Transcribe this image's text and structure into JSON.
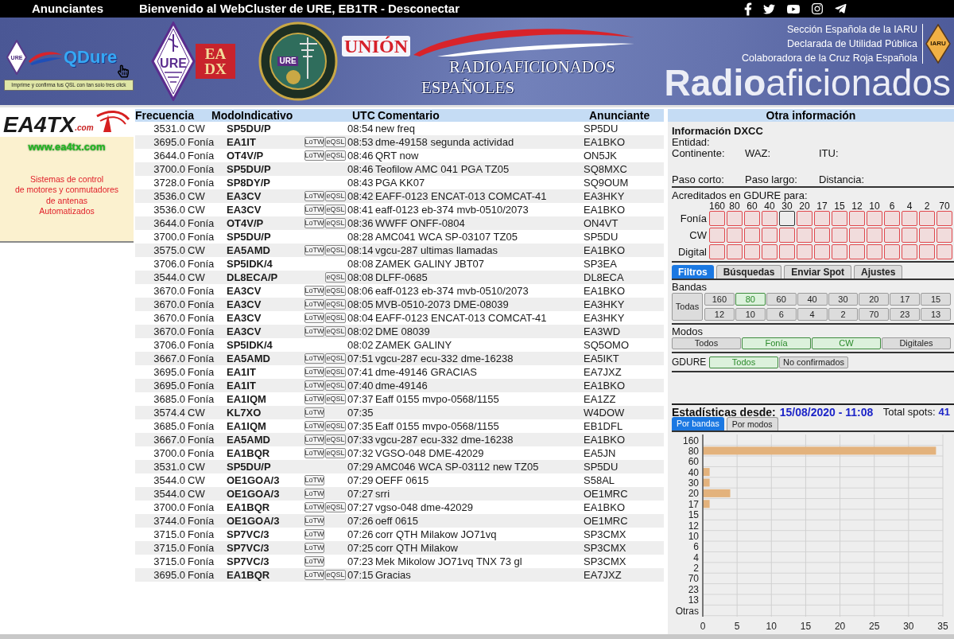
{
  "top_bar": {
    "advertisers_link": "Anunciantes",
    "welcome": "Bienvenido al WebCluster de URE, EB1TR -",
    "logout_link": "Desconectar"
  },
  "banner": {
    "qdure": {
      "badge": "URE",
      "title": "QDure",
      "tagline": "Imprime y confirma tus QSL con tan solo tres click"
    },
    "eadx": {
      "badge": "URE",
      "line_1": "EA",
      "line_2": "DX"
    },
    "seal": {
      "badge": "URE"
    },
    "union": {
      "line_1": "UNIÓN",
      "line_2": "RADIOAFICIONADOS",
      "line_3": "ESPAÑOLES"
    },
    "affiliations": [
      "Sección Española de la IARU",
      "Declarada de Utilidad Pública",
      "Colaboradora de la Cruz Roja Española"
    ],
    "iaru_badge": "IARU",
    "wordmark": "**Radio**aficionados"
  },
  "ad": {
    "logo": "EA4TX",
    "logo_suffix": ".com",
    "url": "www.ea4tx.com",
    "text": "Sistemas de control\nde motores y conmutadores\nde antenas\nAutomatizados"
  },
  "spots": {
    "columns": [
      "Frecuencia",
      "Modo",
      "Indicativo",
      "UTC",
      "Comentario",
      "Anunciante"
    ],
    "rows": [
      {
        "freq": "3531.0",
        "mode": "CW",
        "call": "SP5DU/P",
        "utc": "08:54",
        "comment": "new freq",
        "spotter": "SP5DU"
      },
      {
        "freq": "3695.0",
        "mode": "Fonía",
        "call": "EA1IT",
        "lotw": "LoTW",
        "eqsl": "eQSL",
        "utc": "08:53",
        "comment": "dme-49158 segunda actividad",
        "spotter": "EA1BKO"
      },
      {
        "freq": "3644.0",
        "mode": "Fonía",
        "call": "OT4V/P",
        "lotw": "LoTW",
        "eqsl": "eQSL",
        "utc": "08:46",
        "comment": "QRT now",
        "spotter": "ON5JK"
      },
      {
        "freq": "3700.0",
        "mode": "Fonía",
        "call": "SP5DU/P",
        "utc": "08:46",
        "comment": "Teofilow AMC 041 PGA TZ05",
        "spotter": "SQ8MXC"
      },
      {
        "freq": "3728.0",
        "mode": "Fonía",
        "call": "SP8DY/P",
        "utc": "08:43",
        "comment": "PGA KK07",
        "spotter": "SQ9OUM"
      },
      {
        "freq": "3536.0",
        "mode": "CW",
        "call": "EA3CV",
        "lotw": "LoTW",
        "eqsl": "eQSL",
        "utc": "08:42",
        "comment": "EAFF-0123 ENCAT-013 COMCAT-41",
        "spotter": "EA3HKY"
      },
      {
        "freq": "3536.0",
        "mode": "CW",
        "call": "EA3CV",
        "lotw": "LoTW",
        "eqsl": "eQSL",
        "utc": "08:41",
        "comment": "eaff-0123 eb-374 mvb-0510/2073",
        "spotter": "EA1BKO"
      },
      {
        "freq": "3644.0",
        "mode": "Fonía",
        "call": "OT4V/P",
        "lotw": "LoTW",
        "eqsl": "eQSL",
        "utc": "08:36",
        "comment": "WWFF ONFF-0804",
        "spotter": "ON4VT"
      },
      {
        "freq": "3700.0",
        "mode": "Fonía",
        "call": "SP5DU/P",
        "utc": "08:28",
        "comment": "AMC041 WCA SP-03107 TZ05",
        "spotter": "SP5DU"
      },
      {
        "freq": "3575.0",
        "mode": "CW",
        "call": "EA5AMD",
        "lotw": "LoTW",
        "eqsl": "eQSL",
        "utc": "08:14",
        "comment": "vgcu-287 ultimas llamadas",
        "spotter": "EA1BKO"
      },
      {
        "freq": "3706.0",
        "mode": "Fonía",
        "call": "SP5IDK/4",
        "utc": "08:08",
        "comment": "ZAMEK GALINY JBT07",
        "spotter": "SP3EA"
      },
      {
        "freq": "3544.0",
        "mode": "CW",
        "call": "DL8ECA/P",
        "eqsl": "eQSL",
        "utc": "08:08",
        "comment": "DLFF-0685",
        "spotter": "DL8ECA"
      },
      {
        "freq": "3670.0",
        "mode": "Fonía",
        "call": "EA3CV",
        "lotw": "LoTW",
        "eqsl": "eQSL",
        "utc": "08:06",
        "comment": "eaff-0123 eb-374 mvb-0510/2073",
        "spotter": "EA1BKO"
      },
      {
        "freq": "3670.0",
        "mode": "Fonía",
        "call": "EA3CV",
        "lotw": "LoTW",
        "eqsl": "eQSL",
        "utc": "08:05",
        "comment": "MVB-0510-2073 DME-08039",
        "spotter": "EA3HKY"
      },
      {
        "freq": "3670.0",
        "mode": "Fonía",
        "call": "EA3CV",
        "lotw": "LoTW",
        "eqsl": "eQSL",
        "utc": "08:04",
        "comment": "EAFF-0123 ENCAT-013 COMCAT-41",
        "spotter": "EA3HKY"
      },
      {
        "freq": "3670.0",
        "mode": "Fonía",
        "call": "EA3CV",
        "lotw": "LoTW",
        "eqsl": "eQSL",
        "utc": "08:02",
        "comment": "DME 08039",
        "spotter": "EA3WD"
      },
      {
        "freq": "3706.0",
        "mode": "Fonía",
        "call": "SP5IDK/4",
        "utc": "08:02",
        "comment": "ZAMEK GALINY",
        "spotter": "SQ5OMO"
      },
      {
        "freq": "3667.0",
        "mode": "Fonía",
        "call": "EA5AMD",
        "lotw": "LoTW",
        "eqsl": "eQSL",
        "utc": "07:51",
        "comment": "vgcu-287 ecu-332 dme-16238",
        "spotter": "EA5IKT"
      },
      {
        "freq": "3695.0",
        "mode": "Fonía",
        "call": "EA1IT",
        "lotw": "LoTW",
        "eqsl": "eQSL",
        "utc": "07:41",
        "comment": "dme-49146 GRACIAS",
        "spotter": "EA7JXZ"
      },
      {
        "freq": "3695.0",
        "mode": "Fonía",
        "call": "EA1IT",
        "lotw": "LoTW",
        "eqsl": "eQSL",
        "utc": "07:40",
        "comment": "dme-49146",
        "spotter": "EA1BKO"
      },
      {
        "freq": "3685.0",
        "mode": "Fonía",
        "call": "EA1IQM",
        "lotw": "LoTW",
        "eqsl": "eQSL",
        "utc": "07:37",
        "comment": "Eaff 0155 mvpo-0568/1155",
        "spotter": "EA1ZZ"
      },
      {
        "freq": "3574.4",
        "mode": "CW",
        "call": "KL7XO",
        "lotw": "LoTW",
        "utc": "07:35",
        "spotter": "W4DOW"
      },
      {
        "freq": "3685.0",
        "mode": "Fonía",
        "call": "EA1IQM",
        "lotw": "LoTW",
        "eqsl": "eQSL",
        "utc": "07:35",
        "comment": "Eaff 0155 mvpo-0568/1155",
        "spotter": "EB1DFL"
      },
      {
        "freq": "3667.0",
        "mode": "Fonía",
        "call": "EA5AMD",
        "lotw": "LoTW",
        "eqsl": "eQSL",
        "utc": "07:33",
        "comment": "vgcu-287 ecu-332 dme-16238",
        "spotter": "EA1BKO"
      },
      {
        "freq": "3700.0",
        "mode": "Fonía",
        "call": "EA1BQR",
        "lotw": "LoTW",
        "eqsl": "eQSL",
        "utc": "07:32",
        "comment": "VGSO-048 DME-42029",
        "spotter": "EA5JN"
      },
      {
        "freq": "3531.0",
        "mode": "CW",
        "call": "SP5DU/P",
        "utc": "07:29",
        "comment": "AMC046 WCA SP-03112 new TZ05",
        "spotter": "SP5DU"
      },
      {
        "freq": "3544.0",
        "mode": "CW",
        "call": "OE1GOA/3",
        "lotw": "LoTW",
        "utc": "07:29",
        "comment": "OEFF 0615",
        "spotter": "S58AL"
      },
      {
        "freq": "3544.0",
        "mode": "CW",
        "call": "OE1GOA/3",
        "lotw": "LoTW",
        "utc": "07:27",
        "comment": "srri",
        "spotter": "OE1MRC"
      },
      {
        "freq": "3700.0",
        "mode": "Fonía",
        "call": "EA1BQR",
        "lotw": "LoTW",
        "eqsl": "eQSL",
        "utc": "07:27",
        "comment": "vgso-048 dme-42029",
        "spotter": "EA1BKO"
      },
      {
        "freq": "3744.0",
        "mode": "Fonía",
        "call": "OE1GOA/3",
        "lotw": "LoTW",
        "utc": "07:26",
        "comment": "oeff 0615",
        "spotter": "OE1MRC"
      },
      {
        "freq": "3715.0",
        "mode": "Fonía",
        "call": "SP7VC/3",
        "lotw": "LoTW",
        "utc": "07:26",
        "comment": "corr QTH Milakow JO71vq",
        "spotter": "SP3CMX"
      },
      {
        "freq": "3715.0",
        "mode": "Fonía",
        "call": "SP7VC/3",
        "lotw": "LoTW",
        "utc": "07:25",
        "comment": "corr QTH Milakow",
        "spotter": "SP3CMX"
      },
      {
        "freq": "3715.0",
        "mode": "Fonía",
        "call": "SP7VC/3",
        "lotw": "LoTW",
        "utc": "07:23",
        "comment": "Mek Mikolow JO71vq TNX 73 gl",
        "spotter": "SP3CMX"
      },
      {
        "freq": "3695.0",
        "mode": "Fonía",
        "call": "EA1BQR",
        "lotw": "LoTW",
        "eqsl": "eQSL",
        "utc": "07:15",
        "comment": "Gracias",
        "spotter": "EA7JXZ"
      }
    ]
  },
  "other_info": {
    "title": "Otra información",
    "dxcc": {
      "title": "Información DXCC",
      "entity_label": "Entidad:",
      "continent_label": "Continente:",
      "waz_label": "WAZ:",
      "itu_label": "ITU:",
      "short_path_label": "Paso corto:",
      "long_path_label": "Paso largo:",
      "distance_label": "Distancia:"
    },
    "gdure_grid": {
      "title": "Acreditados en GDURE para:",
      "bands": [
        "160",
        "80",
        "60",
        "40",
        "30",
        "20",
        "17",
        "15",
        "12",
        "10",
        "6",
        "4",
        "2",
        "70"
      ],
      "rows": [
        {
          "label": "Fonía",
          "cells": [
            {
              "missing": true
            },
            {
              "missing": true
            },
            {
              "missing": true
            },
            {
              "missing": true
            },
            {
              "missing": false
            },
            {
              "missing": true
            },
            {
              "missing": true
            },
            {
              "missing": true
            },
            {
              "missing": true
            },
            {
              "missing": true
            },
            {
              "missing": true
            },
            {
              "missing": true
            },
            {
              "missing": true
            },
            {
              "missing": true
            }
          ]
        },
        {
          "label": "CW",
          "cells": [
            {
              "missing": true
            },
            {
              "missing": true
            },
            {
              "missing": true
            },
            {
              "missing": true
            },
            {
              "missing": true
            },
            {
              "missing": true
            },
            {
              "missing": true
            },
            {
              "missing": true
            },
            {
              "missing": true
            },
            {
              "missing": true
            },
            {
              "missing": true
            },
            {
              "missing": true
            },
            {
              "missing": true
            },
            {
              "missing": true
            }
          ]
        },
        {
          "label": "Digital",
          "cells": [
            {
              "missing": true
            },
            {
              "missing": true
            },
            {
              "missing": true
            },
            {
              "missing": true
            },
            {
              "missing": true
            },
            {
              "missing": true
            },
            {
              "missing": true
            },
            {
              "missing": true
            },
            {
              "missing": true
            },
            {
              "missing": true
            },
            {
              "missing": true
            },
            {
              "missing": true
            },
            {
              "missing": true
            },
            {
              "missing": true
            }
          ]
        }
      ]
    },
    "tabs": [
      {
        "label": "Filtros",
        "selected": true
      },
      {
        "label": "Búsquedas",
        "selected": false
      },
      {
        "label": "Enviar Spot",
        "selected": false
      },
      {
        "label": "Ajustes",
        "selected": false
      }
    ],
    "filters": {
      "bands": {
        "label": "Bandas",
        "all": {
          "label": "Todas",
          "selected": false
        },
        "items": [
          {
            "label": "160",
            "selected": false
          },
          {
            "label": "80",
            "selected": true
          },
          {
            "label": "60",
            "selected": false
          },
          {
            "label": "40",
            "selected": false
          },
          {
            "label": "30",
            "selected": false
          },
          {
            "label": "20",
            "selected": false
          },
          {
            "label": "17",
            "selected": false
          },
          {
            "label": "15",
            "selected": false
          },
          {
            "label": "12",
            "selected": false
          },
          {
            "label": "10",
            "selected": false
          },
          {
            "label": "6",
            "selected": false
          },
          {
            "label": "4",
            "selected": false
          },
          {
            "label": "2",
            "selected": false
          },
          {
            "label": "70",
            "selected": false
          },
          {
            "label": "23",
            "selected": false
          },
          {
            "label": "13",
            "selected": false
          }
        ]
      },
      "modes": {
        "label": "Modos",
        "items": [
          {
            "label": "Todos",
            "selected": false
          },
          {
            "label": "Fonía",
            "selected": true
          },
          {
            "label": "CW",
            "selected": true
          },
          {
            "label": "Digitales",
            "selected": false
          }
        ]
      },
      "gdure": {
        "label": "GDURE",
        "items": [
          {
            "label": "Todos",
            "selected": true
          },
          {
            "label": "No confirmados",
            "selected": false
          }
        ]
      }
    },
    "stats": {
      "label": "Estadísticas desde:",
      "since": "15/08/2020 - 11:08",
      "total_label": "Total spots:",
      "total": "41",
      "tabs": [
        {
          "label": "Por bandas",
          "selected": true
        },
        {
          "label": "Por modos",
          "selected": false
        }
      ],
      "chart_data": {
        "type": "bar",
        "orientation": "horizontal",
        "grid": true,
        "categories": [
          "160",
          "80",
          "60",
          "40",
          "30",
          "20",
          "17",
          "15",
          "12",
          "10",
          "6",
          "4",
          "2",
          "70",
          "23",
          "13",
          "Otras"
        ],
        "values": [
          0,
          34,
          0,
          1,
          1,
          4,
          1,
          0,
          0,
          0,
          0,
          0,
          0,
          0,
          0,
          0,
          0
        ],
        "xlim": [
          0,
          35
        ],
        "xticks": [
          0,
          5,
          10,
          15,
          20,
          25,
          30,
          35
        ]
      }
    }
  }
}
